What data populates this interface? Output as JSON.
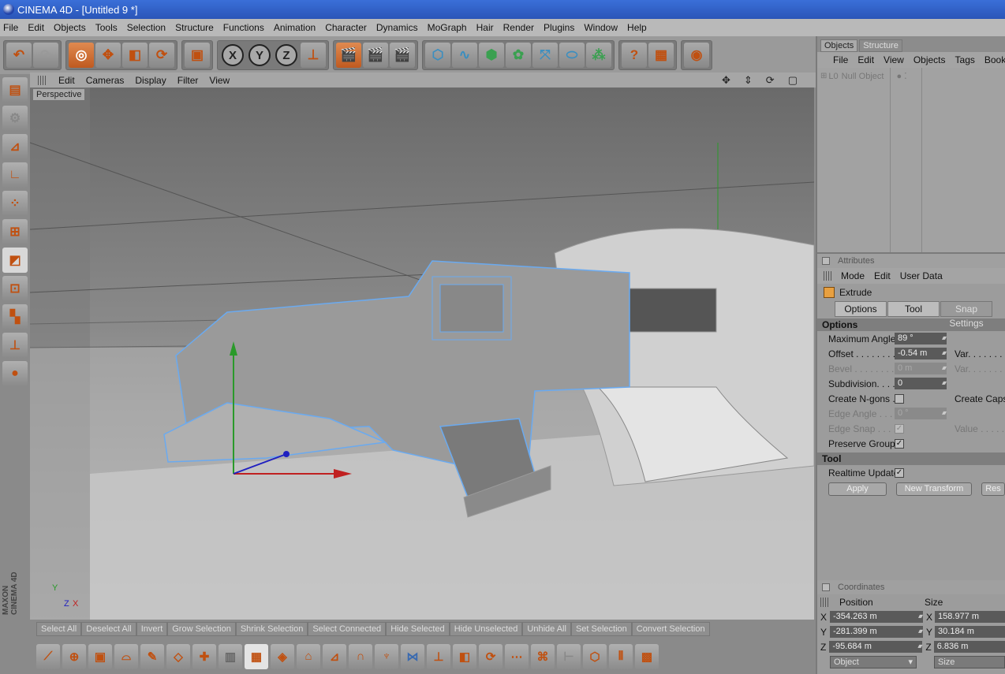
{
  "window": {
    "title": "CINEMA 4D - [Untitled 9 *]"
  },
  "menu": [
    "File",
    "Edit",
    "Objects",
    "Tools",
    "Selection",
    "Structure",
    "Functions",
    "Animation",
    "Character",
    "Dynamics",
    "MoGraph",
    "Hair",
    "Render",
    "Plugins",
    "Window",
    "Help"
  ],
  "toolbar": {
    "groups": [
      {
        "name": "undo-redo",
        "icons": [
          "undo-icon",
          "redo-icon"
        ]
      },
      {
        "name": "transform",
        "icons": [
          "live-selection-icon",
          "move-icon",
          "scale-icon",
          "rotate-icon"
        ]
      },
      {
        "name": "object-mode",
        "icons": [
          "model-object-icon"
        ]
      },
      {
        "name": "axes",
        "icons": [
          "x-axis-lock-icon",
          "y-axis-lock-icon",
          "z-axis-lock-icon",
          "coordinate-system-icon"
        ]
      },
      {
        "name": "render",
        "icons": [
          "render-view-icon",
          "render-picture-viewer-icon",
          "render-settings-icon"
        ]
      },
      {
        "name": "create",
        "icons": [
          "cube-icon",
          "spline-icon",
          "nurbs-icon",
          "array-icon",
          "deformer-icon",
          "scene-object-icon",
          "particles-icon"
        ]
      },
      {
        "name": "help",
        "icons": [
          "help-icon",
          "table-icon"
        ]
      },
      {
        "name": "other",
        "icons": [
          "web-icon"
        ]
      }
    ],
    "axis_labels": [
      "X",
      "Y",
      "Z"
    ]
  },
  "left_tools": [
    "model-icon",
    "texture-icon",
    "object-axis-icon",
    "axis-icon",
    "points-icon",
    "polygons-edges-icon",
    "polygons-icon",
    "uv-icon",
    "edit-icon",
    "checker-icon",
    "workplane-icon",
    "paint-icon"
  ],
  "viewport": {
    "menu": [
      "Edit",
      "Cameras",
      "Display",
      "Filter",
      "View"
    ],
    "label": "Perspective",
    "axis_labels": {
      "y": "Y",
      "z": "Z",
      "x": "X"
    }
  },
  "objects_panel": {
    "tabs": [
      "Objects",
      "Structure"
    ],
    "menu": [
      "File",
      "Edit",
      "View",
      "Objects",
      "Tags",
      "Book"
    ],
    "items": [
      {
        "name": "Null Object"
      }
    ]
  },
  "attributes": {
    "title": "Attributes",
    "menu": [
      "Mode",
      "Edit",
      "User Data"
    ],
    "tool_name": "Extrude",
    "tabs": [
      "Options",
      "Tool",
      "Snap Settings"
    ],
    "options_header": "Options",
    "rows": {
      "max_angle": {
        "label": "Maximum Angle",
        "value": "89 °"
      },
      "offset": {
        "label": "Offset . . . . . . . .",
        "value": "-0.54 m",
        "right": "Var. . . . . . ."
      },
      "bevel": {
        "label": "Bevel . . . . . . . .",
        "value": "0 m",
        "right": "Var. . . . . . ."
      },
      "subdivision": {
        "label": "Subdivision. . . .",
        "value": "0"
      },
      "create_ngons": {
        "label": "Create N-gons . .",
        "checked": "",
        "right": "Create Caps"
      },
      "edge_angle": {
        "label": "Edge Angle . . . .",
        "value": "0 °"
      },
      "edge_snap": {
        "label": "Edge Snap . . . .",
        "checked": "✓",
        "right": "Value . . . . . ."
      },
      "preserve_groups": {
        "label": "Preserve Groups",
        "checked": "✓"
      }
    },
    "tool_header": "Tool",
    "realtime_update": {
      "label": "Realtime Update",
      "checked": "✓"
    },
    "buttons": {
      "apply": "Apply",
      "new_transform": "New Transform",
      "reset": "Res"
    }
  },
  "coordinates": {
    "title": "Coordinates",
    "position_label": "Position",
    "size_label": "Size",
    "axes": [
      "X",
      "Y",
      "Z"
    ],
    "position": [
      "-354.263 m",
      "-281.399 m",
      "-95.684 m"
    ],
    "size": [
      "158.977 m",
      "30.184 m",
      "6.836 m"
    ],
    "mode": "Object",
    "size_mode": "Size"
  },
  "selection_bar": [
    "Select All",
    "Deselect All",
    "Invert",
    "Grow Selection",
    "Shrink Selection",
    "Select Connected",
    "Hide Selected",
    "Hide Unselected",
    "Unhide All",
    "Set Selection",
    "Convert Selection"
  ],
  "bottom_tools": [
    "knife-icon",
    "add-points-icon",
    "extrude-icon",
    "bridge-icon",
    "brush-icon",
    "plane-cut-icon",
    "add-icon",
    "matrix-icon",
    "extrude-tool-icon",
    "extrude-inner-icon",
    "bevel-icon",
    "smooth-shift-icon",
    "magnet-icon",
    "slide-icon",
    "mirror-icon",
    "set-point-icon",
    "weld-icon",
    "iron-icon",
    "stitch-icon",
    "edge-cut-icon",
    "split-icon",
    "triangulate-icon",
    "align-icon",
    "optimize-icon",
    "subdivide-icon",
    "clone-icon"
  ],
  "branding": "MAXON CINEMA 4D",
  "colors": {
    "title_bar": "#2a55b8",
    "accent": "#c05010",
    "wireframe": "#6aaaf0"
  }
}
